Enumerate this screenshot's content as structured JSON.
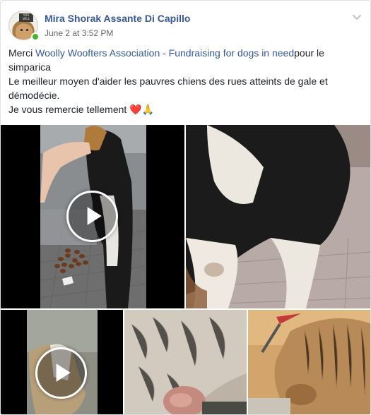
{
  "post": {
    "author": "Mira Shorak Assante Di Capillo",
    "timestamp": "June 2 at 3:52 PM",
    "avatar_sign_text": "YOU WILL\nBE MINE",
    "line1_prefix": "Merci ",
    "line1_link": "Woolly Woofters Association - Fundraising for dogs in need",
    "line1_suffix": "pour le simparica",
    "line2": "Le meilleur moyen d'aider les pauvres chiens des rues atteints de gale et démodécie.",
    "line3": "Je vous remercie tellement ",
    "line3_emoji_heart": "❤️",
    "line3_emoji_pray": "🙏"
  },
  "media": [
    {
      "type": "video",
      "description": "hand feeding dog"
    },
    {
      "type": "photo",
      "description": "dog side view"
    },
    {
      "type": "video",
      "description": "dog on street"
    },
    {
      "type": "photo",
      "description": "skin close-up"
    },
    {
      "type": "photo",
      "description": "dog eating"
    }
  ],
  "icons": {
    "chevron": "chevron-down-icon",
    "play": "play-icon",
    "online": "online-status-icon"
  },
  "colors": {
    "link": "#365899",
    "meta": "#616770",
    "online": "#42b72a"
  }
}
